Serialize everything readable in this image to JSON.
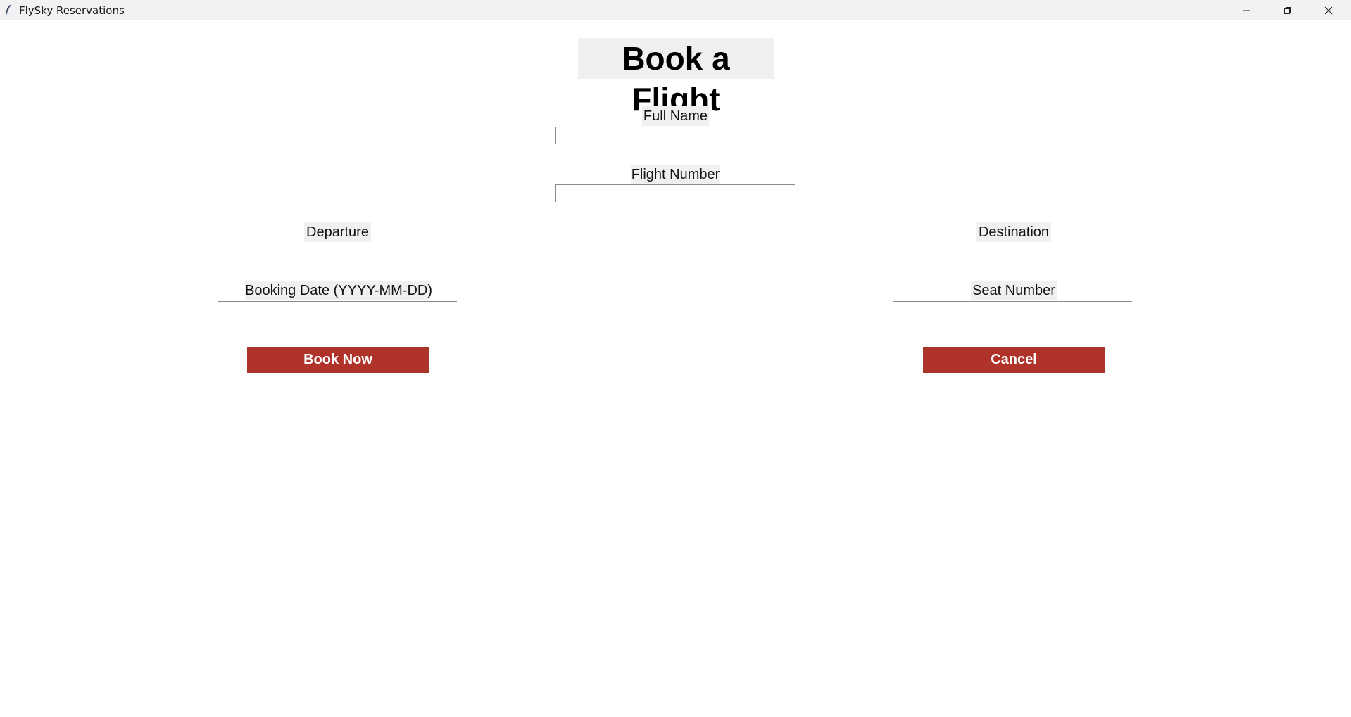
{
  "window": {
    "title": "FlySky Reservations",
    "controls": [
      "minimize",
      "restore",
      "close"
    ]
  },
  "form": {
    "heading": "Book a Flight",
    "fields": {
      "full_name": {
        "label": "Full Name",
        "value": ""
      },
      "flight_number": {
        "label": "Flight Number",
        "value": ""
      },
      "departure": {
        "label": "Departure",
        "value": ""
      },
      "destination": {
        "label": "Destination",
        "value": ""
      },
      "booking_date": {
        "label": "Booking Date (YYYY-MM-DD)",
        "value": ""
      },
      "seat_number": {
        "label": "Seat Number",
        "value": ""
      }
    },
    "buttons": {
      "book": "Book Now",
      "cancel": "Cancel"
    }
  },
  "colors": {
    "button_bg": "#b0332b",
    "button_text": "#ffffff",
    "label_bg": "#f0f0f0",
    "titlebar_bg": "#f3f1f4"
  },
  "icons": {
    "app": "feather-icon",
    "minimize": "minimize-icon",
    "restore": "restore-icon",
    "close": "close-icon"
  }
}
